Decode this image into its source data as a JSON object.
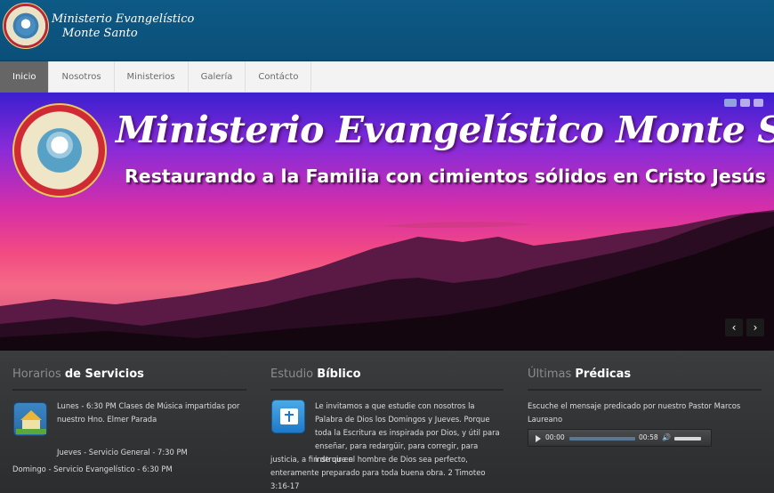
{
  "header": {
    "logo_line1": "Ministerio Evangelístico",
    "logo_line2": "Monte Santo"
  },
  "nav": {
    "items": [
      {
        "label": "Inicio",
        "active": true
      },
      {
        "label": "Nosotros"
      },
      {
        "label": "Ministerios"
      },
      {
        "label": "Galería"
      },
      {
        "label": "Contácto"
      }
    ]
  },
  "hero": {
    "title": "Ministerio Evangelístico Monte Santo",
    "subtitle": "Restaurando a la Familia con cimientos sólidos en Cristo Jesús",
    "prev_arrow": "‹",
    "next_arrow": "›"
  },
  "sections": {
    "schedule": {
      "title_light": "Horarios",
      "title_strong": "de Servicios",
      "line1": "Lunes - 6:30 PM Clases de Música impartidas por nuestro Hno. Elmer Parada",
      "line2": "Jueves - Servicio General - 7:30 PM",
      "line3": "Domingo - Servicio Evangelístico - 6:30 PM"
    },
    "study": {
      "title_light": "Estudio",
      "title_strong": "Bíblico",
      "text_intro": "Le invitamos a que estudie con nosotros la Palabra de Dios los Domingos y Jueves. Porque toda la Escritura es inspirada por Dios, y útil para enseñar, para redargüir, para corregir, para instruir en",
      "text_rest": "justicia, a fin de que el hombre de Dios sea perfecto, enteramente preparado para toda buena obra. 2 Timoteo 3:16-17"
    },
    "sermons": {
      "title_light": "Últimas",
      "title_strong": "Prédicas",
      "text": "Escuche el mensaje predicado por nuestro Pastor Marcos Laureano",
      "player_current": "00:00",
      "player_duration": "00:58",
      "volume_icon": "🔊"
    }
  },
  "icons": {
    "schedule": "church-icon",
    "study": "bible-icon"
  }
}
